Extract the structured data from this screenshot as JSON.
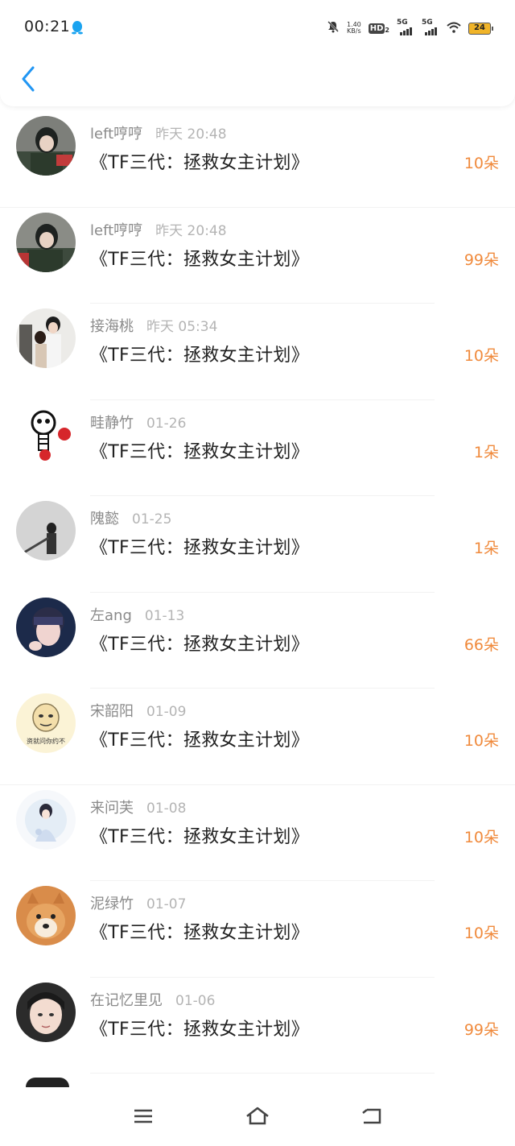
{
  "status_bar": {
    "time": "00:21",
    "net_speed_value": "1.40",
    "net_speed_unit": "KB/s",
    "hd_label": "HD",
    "hd_sub": "2",
    "signal1": "5G",
    "signal2": "5G",
    "battery": "24"
  },
  "header": {
    "back_icon": "chevron-left-icon"
  },
  "items": [
    {
      "name": "left哼哼",
      "time": "昨天 20:48",
      "title": "《TF三代：拯救女主计划》",
      "amount": "10朵"
    },
    {
      "name": "left哼哼",
      "time": "昨天 20:48",
      "title": "《TF三代：拯救女主计划》",
      "amount": "99朵"
    },
    {
      "name": "接海桃",
      "time": "昨天 05:34",
      "title": "《TF三代：拯救女主计划》",
      "amount": "10朵"
    },
    {
      "name": "畦静竹",
      "time": "01-26",
      "title": "《TF三代：拯救女主计划》",
      "amount": "1朵"
    },
    {
      "name": "隗懿",
      "time": "01-25",
      "title": "《TF三代：拯救女主计划》",
      "amount": "1朵"
    },
    {
      "name": "左ang",
      "time": "01-13",
      "title": "《TF三代：拯救女主计划》",
      "amount": "66朵"
    },
    {
      "name": "宋韶阳",
      "time": "01-09",
      "title": "《TF三代：拯救女主计划》",
      "amount": "10朵"
    },
    {
      "name": "来问芙",
      "time": "01-08",
      "title": "《TF三代：拯救女主计划》",
      "amount": "10朵"
    },
    {
      "name": "泥绿竹",
      "time": "01-07",
      "title": "《TF三代：拯救女主计划》",
      "amount": "10朵"
    },
    {
      "name": "在记忆里见",
      "time": "01-06",
      "title": "《TF三代：拯救女主计划》",
      "amount": "99朵"
    }
  ],
  "nav": {
    "menu_icon": "menu-icon",
    "home_icon": "home-icon",
    "back_icon": "back-icon"
  },
  "colors": {
    "accent": "#2196f3",
    "amount": "#f08a3c",
    "battery": "#f0b429"
  }
}
